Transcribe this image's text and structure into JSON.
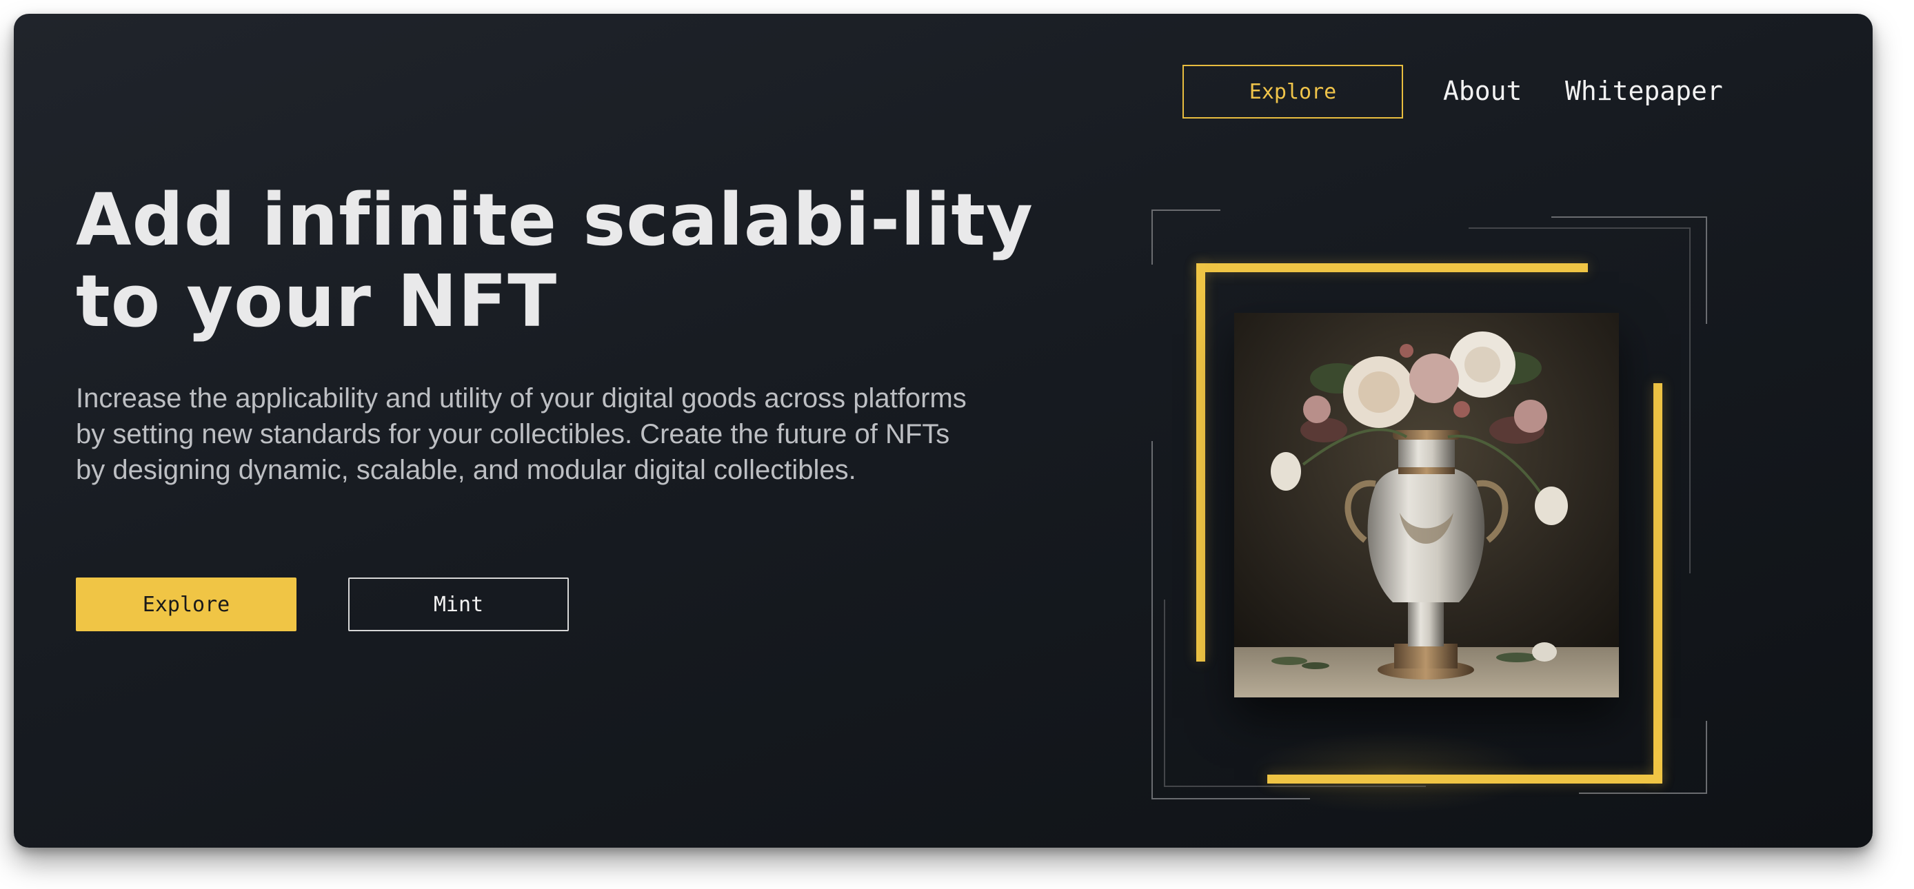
{
  "nav": {
    "explore_label": "Explore",
    "about_label": "About",
    "whitepaper_label": "Whitepaper"
  },
  "hero": {
    "title_line1": "Add infinite scalabi-lity",
    "title_line2": "to your NFT",
    "description": "Increase the applicability and utility of your digital goods across platforms by setting new standards for your collectibles.  Create the future of NFTs by designing dynamic, scalable, and modular digital collectibles.",
    "explore_label": "Explore",
    "mint_label": "Mint"
  },
  "artwork": {
    "subject": "vase-with-flowers-image"
  },
  "colors": {
    "accent": "#f0c545",
    "background": "#171b21",
    "text": "#e9e9ea",
    "muted_text": "#bdbfc3"
  }
}
